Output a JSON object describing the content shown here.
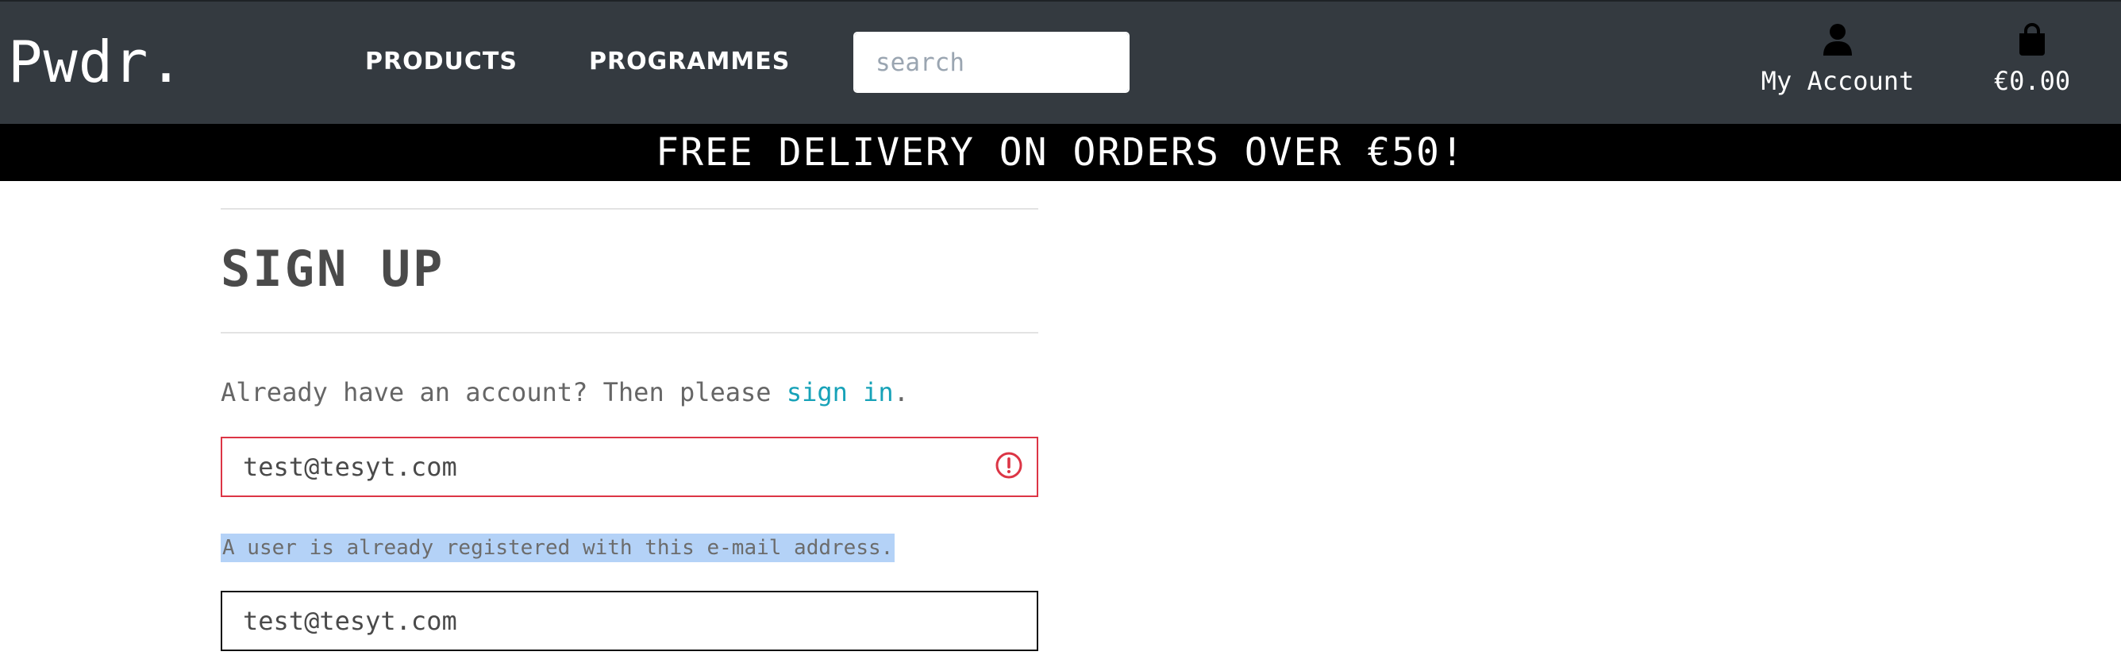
{
  "brand": "Pwdr.",
  "nav": {
    "products": "PRODUCTS",
    "programmes": "PROGRAMMES"
  },
  "search": {
    "placeholder": "search",
    "button_icon": "search-icon"
  },
  "account": {
    "label": "My Account",
    "icon": "user-icon"
  },
  "cart": {
    "total": "€0.00",
    "icon": "shopping-bag-icon"
  },
  "banner": "FREE DELIVERY ON ORDERS OVER €50!",
  "page": {
    "title": "SIGN UP",
    "signin_prefix": "Already have an account? Then please ",
    "signin_link": "sign in",
    "signin_suffix": "."
  },
  "form": {
    "email": "test@tesyt.com",
    "email_error": "A user is already registered with this e-mail address.",
    "email_confirm": "test@tesyt.com"
  },
  "colors": {
    "navbar": "#343a40",
    "banner": "#000000",
    "link": "#17a2b8",
    "error": "#dc3545",
    "selection": "#b4d2f7"
  }
}
